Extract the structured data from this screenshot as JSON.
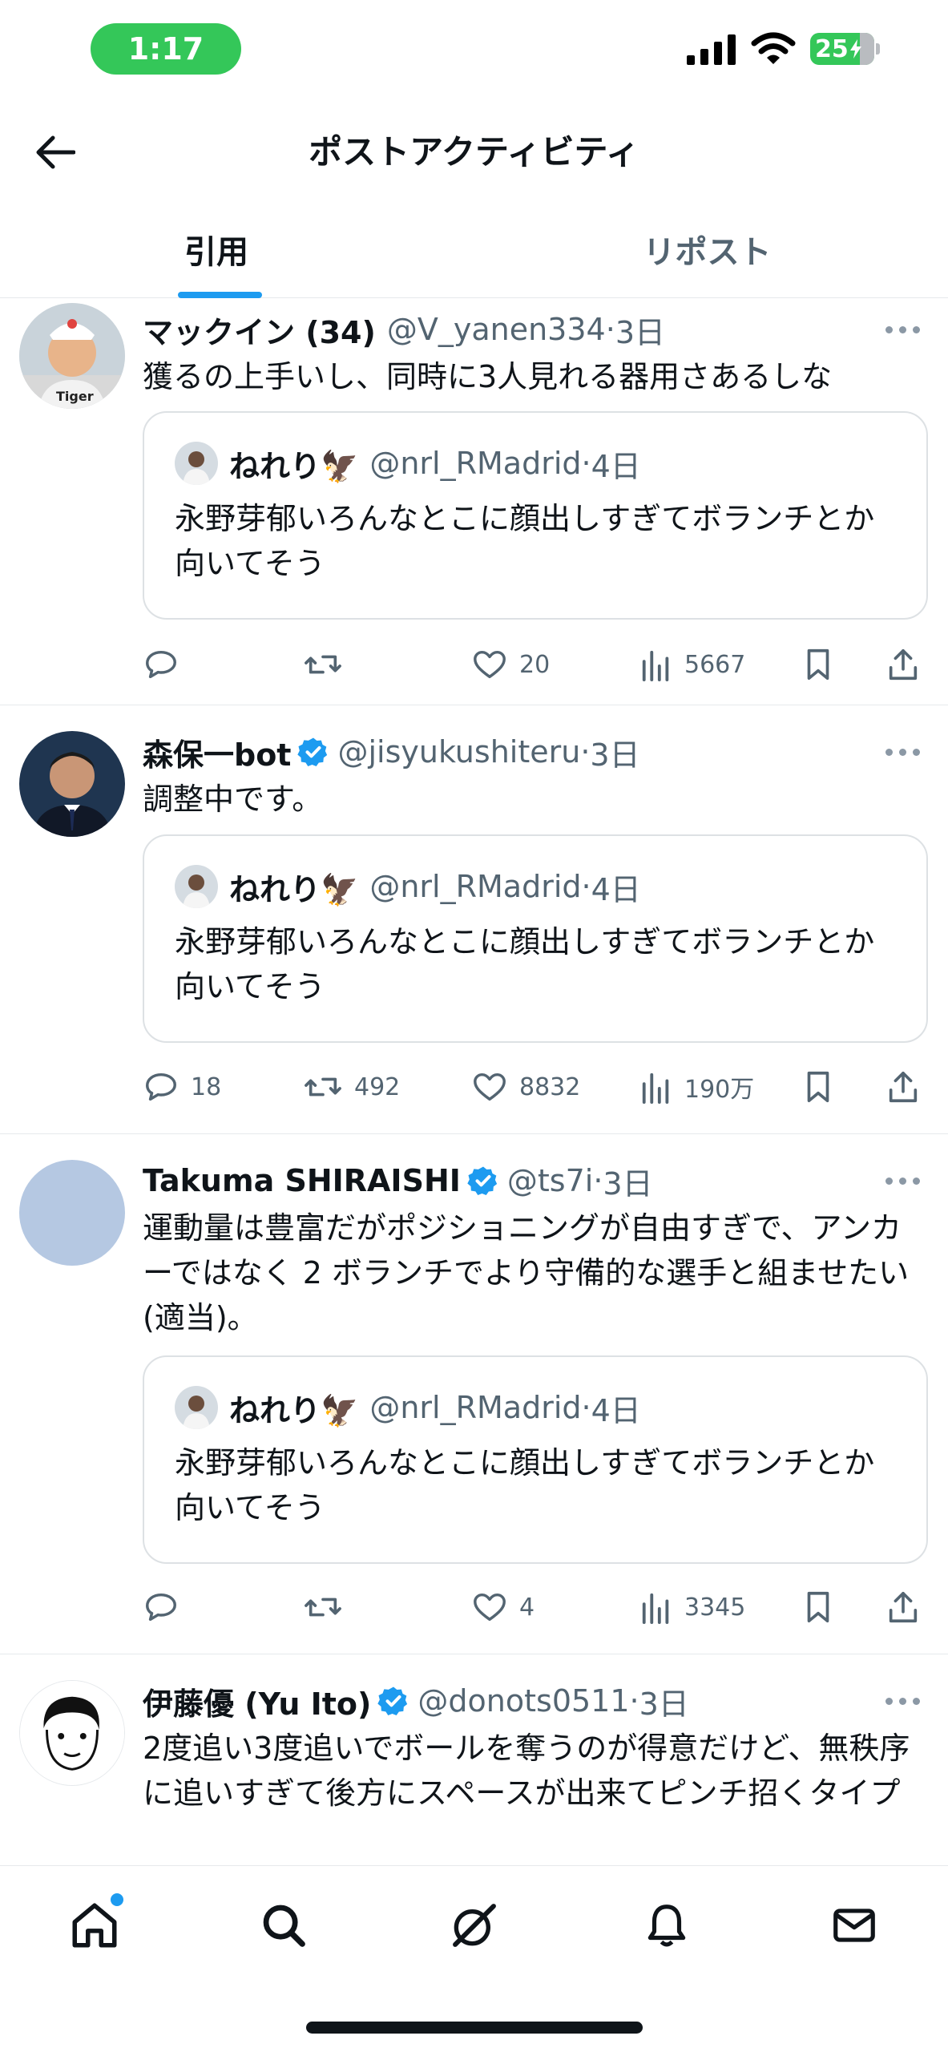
{
  "status_bar": {
    "time": "1:17",
    "battery": "25"
  },
  "header": {
    "title": "ポストアクティビティ"
  },
  "tabs": [
    {
      "label": "引用",
      "active": true
    },
    {
      "label": "リポスト",
      "active": false
    }
  ],
  "quoted_post": {
    "name": "ねれり🦅",
    "handle": "@nrl_RMadrid",
    "time": "4日",
    "text": "永野芽郁いろんなとこに顔出しすぎてボランチとか向いてそう"
  },
  "posts": [
    {
      "name": "マックイン (34)",
      "handle": "@V_yanen334",
      "time": "3日",
      "verified": false,
      "text": "獲るの上手いし、同時に3人見れる器用さあるしな",
      "stats": {
        "replies": "",
        "reposts": "",
        "likes": "20",
        "views": "5667"
      }
    },
    {
      "name": "森保一bot",
      "handle": "@jisyukushiteru",
      "time": "3日",
      "verified": true,
      "text": "調整中です。",
      "stats": {
        "replies": "18",
        "reposts": "492",
        "likes": "8832",
        "views": "190万"
      }
    },
    {
      "name": "Takuma SHIRAISHI",
      "handle": "@ts7i",
      "time": "3日",
      "verified": true,
      "text": "運動量は豊富だがポジショニングが自由すぎで、アンカーではなく 2 ボランチでより守備的な選手と組ませたい (適当)。",
      "stats": {
        "replies": "",
        "reposts": "",
        "likes": "4",
        "views": "3345"
      }
    },
    {
      "name": "伊藤優 (Yu Ito)",
      "handle": "@donots0511",
      "time": "3日",
      "verified": true,
      "text": "2度追い3度追いでボールを奪うのが得意だけど、無秩序に追いすぎて後方にスペースが出来てピンチ招くタイプ"
    }
  ],
  "colors": {
    "accent": "#1d9bf0",
    "secondary_text": "#536471",
    "status_green": "#34c759"
  }
}
